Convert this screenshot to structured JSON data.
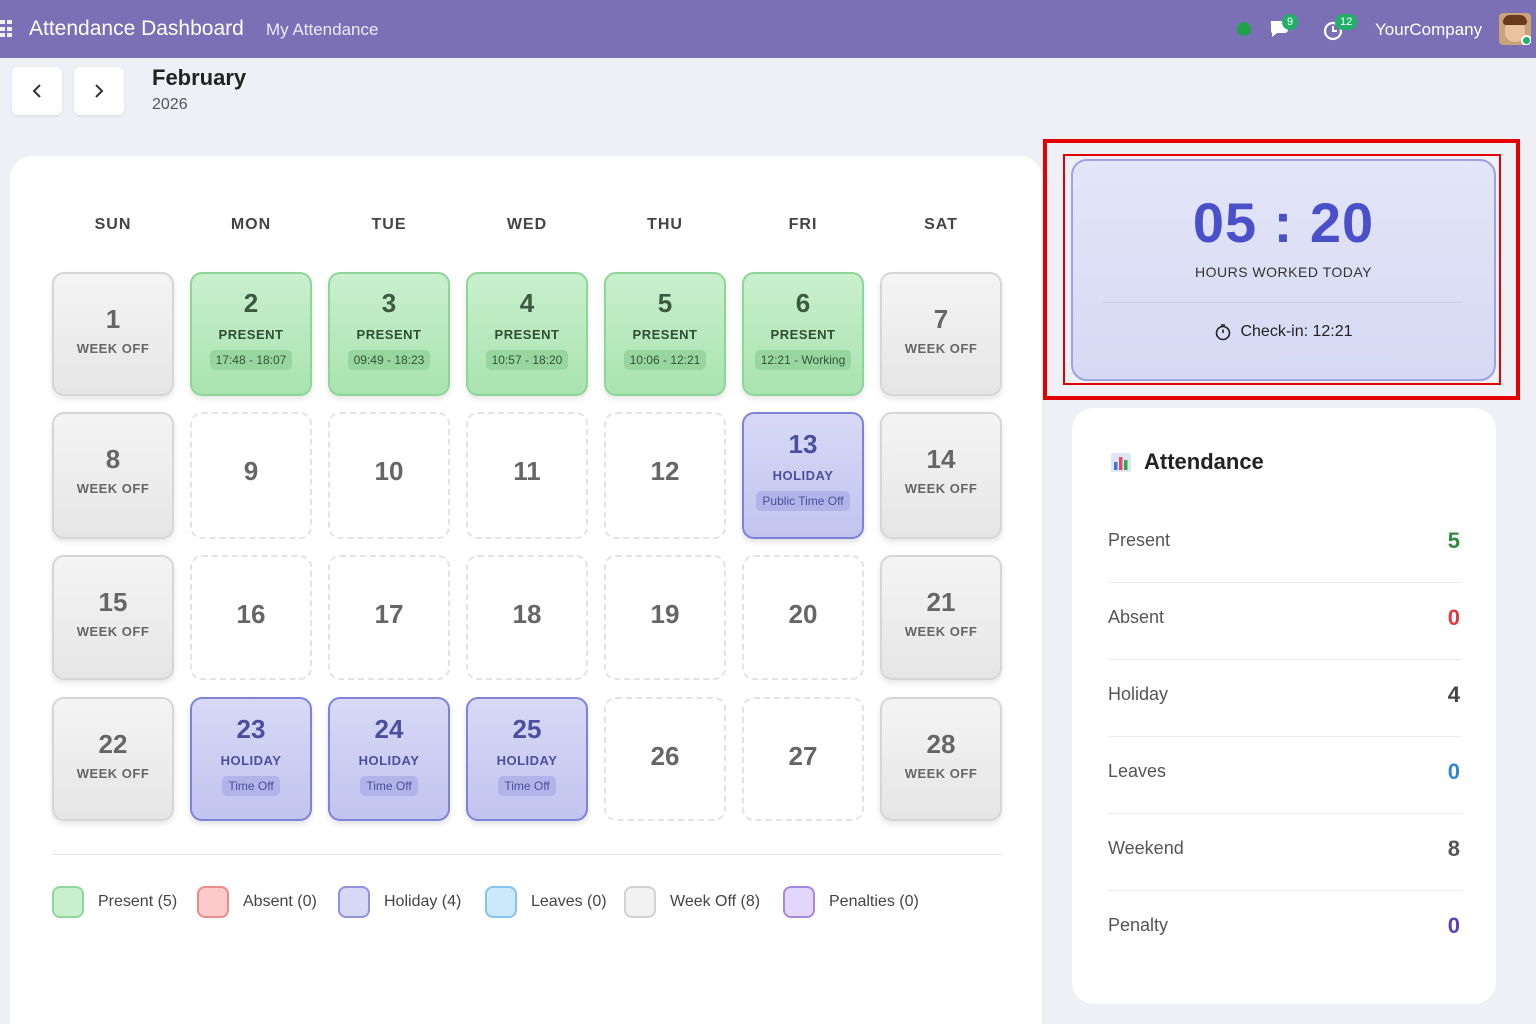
{
  "topbar": {
    "app_title": "Attendance Dashboard",
    "nav_link": "My Attendance",
    "chat_badge": "9",
    "activity_badge": "12",
    "company": "YourCompany"
  },
  "header": {
    "prev_icon": "chevron-left-icon",
    "next_icon": "chevron-right-icon",
    "month": "February",
    "year": "2026"
  },
  "calendar": {
    "weekdays": [
      "SUN",
      "MON",
      "TUE",
      "WED",
      "THU",
      "FRI",
      "SAT"
    ],
    "days": [
      {
        "num": "1",
        "label": "WEEK OFF",
        "status": "weekoff"
      },
      {
        "num": "2",
        "label": "PRESENT",
        "detail": "17:48 - 18:07",
        "status": "present"
      },
      {
        "num": "3",
        "label": "PRESENT",
        "detail": "09:49 - 18:23",
        "status": "present"
      },
      {
        "num": "4",
        "label": "PRESENT",
        "detail": "10:57 - 18:20",
        "status": "present"
      },
      {
        "num": "5",
        "label": "PRESENT",
        "detail": "10:06 - 12:21",
        "status": "present"
      },
      {
        "num": "6",
        "label": "PRESENT",
        "detail": "12:21 - Working",
        "status": "present"
      },
      {
        "num": "7",
        "label": "WEEK OFF",
        "status": "weekoff"
      },
      {
        "num": "8",
        "label": "WEEK OFF",
        "status": "weekoff"
      },
      {
        "num": "9",
        "status": "empty"
      },
      {
        "num": "10",
        "status": "empty"
      },
      {
        "num": "11",
        "status": "empty"
      },
      {
        "num": "12",
        "status": "empty"
      },
      {
        "num": "13",
        "label": "HOLIDAY",
        "detail": "Public Time Off",
        "status": "holiday"
      },
      {
        "num": "14",
        "label": "WEEK OFF",
        "status": "weekoff"
      },
      {
        "num": "15",
        "label": "WEEK OFF",
        "status": "weekoff"
      },
      {
        "num": "16",
        "status": "empty"
      },
      {
        "num": "17",
        "status": "empty"
      },
      {
        "num": "18",
        "status": "empty"
      },
      {
        "num": "19",
        "status": "empty"
      },
      {
        "num": "20",
        "status": "empty"
      },
      {
        "num": "21",
        "label": "WEEK OFF",
        "status": "weekoff"
      },
      {
        "num": "22",
        "label": "WEEK OFF",
        "status": "weekoff"
      },
      {
        "num": "23",
        "label": "HOLIDAY",
        "detail": "Time Off",
        "status": "holiday"
      },
      {
        "num": "24",
        "label": "HOLIDAY",
        "detail": "Time Off",
        "status": "holiday"
      },
      {
        "num": "25",
        "label": "HOLIDAY",
        "detail": "Time Off",
        "status": "holiday"
      },
      {
        "num": "26",
        "status": "empty"
      },
      {
        "num": "27",
        "status": "empty"
      },
      {
        "num": "28",
        "label": "WEEK OFF",
        "status": "weekoff"
      }
    ]
  },
  "legend": [
    {
      "text": "Present (5)",
      "fill": "#c8f0cd",
      "border": "#8fd69a"
    },
    {
      "text": "Absent (0)",
      "fill": "#fbcaca",
      "border": "#ef8a8a"
    },
    {
      "text": "Holiday (4)",
      "fill": "#d6d8f5",
      "border": "#8f92dd"
    },
    {
      "text": "Leaves (0)",
      "fill": "#cde8fb",
      "border": "#84c4ef"
    },
    {
      "text": "Week Off (8)",
      "fill": "#f1f1f1",
      "border": "#d2d2d2"
    },
    {
      "text": "Penalties (0)",
      "fill": "#e3d6fb",
      "border": "#a588e0"
    }
  ],
  "timer": {
    "value": "05 : 20",
    "label": "HOURS WORKED TODAY",
    "checkin": "Check-in: 12:21",
    "checkin_icon": "stopwatch-icon"
  },
  "stats": {
    "title": "Attendance",
    "title_icon": "bar-chart-icon",
    "rows": [
      {
        "label": "Present",
        "value": "5",
        "color": "#2f8a3c"
      },
      {
        "label": "Absent",
        "value": "0",
        "color": "#e0393e"
      },
      {
        "label": "Holiday",
        "value": "4",
        "color": "#444444"
      },
      {
        "label": "Leaves",
        "value": "0",
        "color": "#2f86d6"
      },
      {
        "label": "Weekend",
        "value": "8",
        "color": "#555555"
      },
      {
        "label": "Penalty",
        "value": "0",
        "color": "#5b3fb5"
      }
    ]
  }
}
